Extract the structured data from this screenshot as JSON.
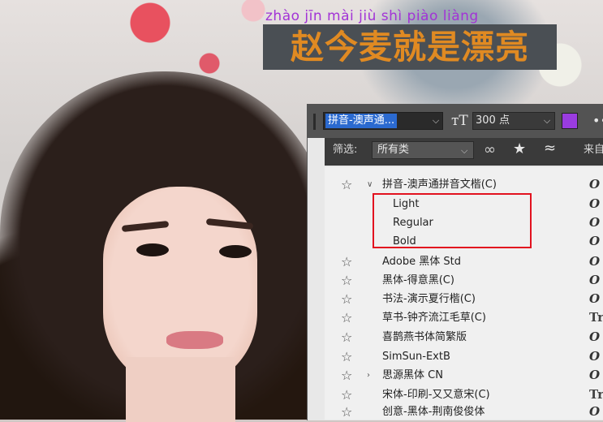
{
  "title": {
    "pinyin": "zhào jīn mài jiù shì piào liàng",
    "hanzi": "赵今麦就是漂亮"
  },
  "toolbar": {
    "font_family": "拼音-澳声通...",
    "size": "300 点",
    "color": "#9a3ce0",
    "text_icon": "TT-icon",
    "more": "•••"
  },
  "filter": {
    "label": "筛选:",
    "value": "所有类",
    "source": "来自"
  },
  "fonts": [
    {
      "name": "拼音-澳声通拼音文楷(C)",
      "expanded": true,
      "preview": "O"
    },
    {
      "name": "Light",
      "style": true,
      "preview": "O"
    },
    {
      "name": "Regular",
      "style": true,
      "preview": "O"
    },
    {
      "name": "Bold",
      "style": true,
      "preview": "O"
    },
    {
      "name": "Adobe 黑体 Std",
      "preview": "O"
    },
    {
      "name": "黑体-得意黑(C)",
      "preview": "O"
    },
    {
      "name": "书法-演示夏行楷(C)",
      "preview": "O"
    },
    {
      "name": "草书-钟齐流江毛草(C)",
      "preview": "Tr"
    },
    {
      "name": "喜鹊燕书体简繁版",
      "preview": "O"
    },
    {
      "name": "SimSun-ExtB",
      "preview": "O"
    },
    {
      "name": "思源黑体 CN",
      "collapsed": true,
      "preview": "O"
    },
    {
      "name": "宋体-印刷-又又意宋(C)",
      "preview": "Tr"
    },
    {
      "name": "创意-黑体-荆南俊俊体",
      "preview": "O"
    }
  ],
  "colors": {
    "pinyin": "#a233d6",
    "hanzi": "#e08a22",
    "highlight": "#e2121f"
  }
}
